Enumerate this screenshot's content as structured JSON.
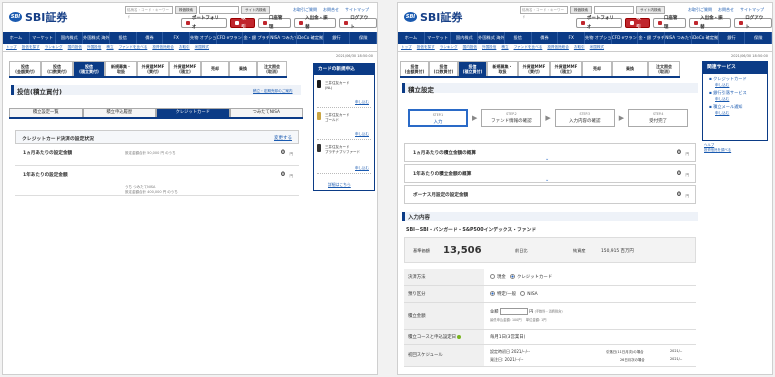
{
  "header": {
    "logo_mark": "SBI",
    "logo_text": "SBI証券",
    "search_placeholder": "銘柄名・コード・キーワード",
    "search_button": "株価検索",
    "site_search_button": "サイト内検索",
    "top_links": [
      "お取引ご質問",
      "お問合せ",
      "サイトマップ"
    ],
    "buttons": [
      "ポートフォリオ",
      "取引",
      "口座管理",
      "入出金・振替",
      "ログアウト"
    ]
  },
  "global_nav": [
    "ホーム",
    "マーケット",
    "国内株式",
    "外国株式 海外ETF",
    "投信",
    "債券",
    "FX",
    "先物 オプション",
    "CFD eワラント",
    "金・銀 プラチナ",
    "NISA つみたてNISA",
    "iDeCo 確定拠出年金",
    "銀行",
    "保険"
  ],
  "sub_nav": [
    "トップ",
    "投信を探す",
    "ランキング",
    "国内投信",
    "外国投信",
    "積立",
    "ファンドを比べる",
    "投資信託総合",
    "お取引",
    "米国株式",
    "外国投資",
    "外貨建MMF",
    "外貨建MMF(積立)"
  ],
  "timestamp": "2021/06/30 18:50:00",
  "product_tabs": [
    {
      "l1": "投信",
      "l2": "(金額買付)"
    },
    {
      "l1": "投信",
      "l2": "(口数買付)"
    },
    {
      "l1": "投信",
      "l2": "(積立買付)"
    },
    {
      "l1": "新規募集・",
      "l2": "取扱"
    },
    {
      "l1": "外貨建MMF",
      "l2": "(買付)"
    },
    {
      "l1": "外貨建MMF",
      "l2": "(積立)"
    },
    {
      "l1": "売却",
      "l2": ""
    },
    {
      "l1": "乗換",
      "l2": ""
    },
    {
      "l1": "注文照会",
      "l2": "(取消)"
    }
  ],
  "left": {
    "title": "投信(積立買付)",
    "help_link": "積立・定期売却のご案内",
    "sub_tabs": [
      "積立設定一覧",
      "積立申込履歴",
      "クレジットカード",
      "つみたてNISA"
    ],
    "credit_box": {
      "title": "クレジットカード決済の設定状況",
      "change_link": "変更する",
      "monthly_label": "1ヵ月あたりの設定金額",
      "monthly_value": "0",
      "monthly_unit": "円",
      "monthly_note": "設定金額合計 50,000 円 のうち",
      "annual_label": "1年あたりの設定金額",
      "annual_value": "0",
      "annual_unit": "円",
      "annual_note1": "うち つみたてNISA",
      "annual_note2": "設定金額合計 400,000 円 のうち"
    },
    "side": {
      "title": "カードの新規申込",
      "cards": [
        {
          "name": "三井住友カード",
          "sub": "(NL)",
          "more": "申し込む",
          "color": "#1a1a1a"
        },
        {
          "name": "三井住友カード",
          "sub": "ゴールド",
          "more": "申し込む",
          "color": "#c9a544"
        },
        {
          "name": "三井住友カード",
          "sub": "プラチナプリファード",
          "more": "申し込む",
          "color": "#333333"
        }
      ],
      "details": "詳細はこちら"
    }
  },
  "right": {
    "title": "積立設定",
    "steps": [
      {
        "num": "STEP.1",
        "label": "入力"
      },
      {
        "num": "STEP.2",
        "label": "ファンド情報の確認"
      },
      {
        "num": "STEP.3",
        "label": "入力内容の確認"
      },
      {
        "num": "STEP.4",
        "label": "受付完了"
      }
    ],
    "summary_rows": [
      {
        "label": "1ヵ月あたりの積立金額の概算",
        "value": "0",
        "unit": "円"
      },
      {
        "label": "1年あたりの積立金額の概算",
        "value": "0",
        "unit": "円"
      },
      {
        "label": "ボーナス月設定の設定金額",
        "value": "0",
        "unit": "円"
      }
    ],
    "input_title": "入力内容",
    "fund_name": "SBI－SBI・バンガード・S&P500インデックス・ファンド",
    "nav_label": "基準価額",
    "nav_value": "13,506",
    "prev_label": "前日比",
    "net_label": "純資産",
    "net_value": "150,915 百万円",
    "form": {
      "payment_label": "決済方法",
      "payment_opt1": "現金",
      "payment_opt2": "クレジットカード",
      "account_label": "預り区分",
      "account_opt1": "特定/一般",
      "account_opt2": "NISA",
      "amount_label": "積立金額",
      "amount_prefix": "金額",
      "amount_unit": "円",
      "amount_note": "(手数料・消費税含)",
      "amount_min": "最低申込金額: 100円",
      "amount_step": "単位金額: 1円",
      "course_label": "積立コースと申込設定日",
      "course_value": "毎月1日(3営業日)",
      "schedule_label": "初回スケジュール",
      "schedule_1": "設定時初日  2021/--/--",
      "schedule_2": "発注日:  2021/--/--",
      "schedule_r1": "引落日(11日月次)の場合",
      "schedule_r2": "26日月次の場合",
      "schedule_r1v": "2021/--",
      "schedule_r2v": "2021/--"
    },
    "side": {
      "title": "関連サービス",
      "items": [
        "クレジットカード",
        "銀行引落サービス",
        "積立メール通知"
      ],
      "apply": "申し込む",
      "links": [
        "ヘルプ",
        "投資信託を調べる"
      ]
    }
  }
}
